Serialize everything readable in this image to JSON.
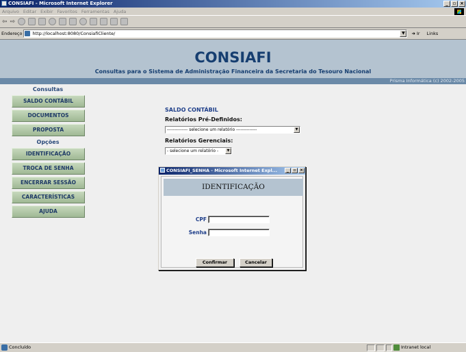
{
  "browser": {
    "window_title": "CONSIAFI - Microsoft Internet Explorer",
    "menu": [
      "Arquivo",
      "Editar",
      "Exibir",
      "Favoritos",
      "Ferramentas",
      "Ajuda"
    ],
    "address_label": "Endereço",
    "url": "http://localhost:8080/ConsiafiCliente/",
    "go_label": "Ir",
    "links_label": "Links",
    "status_text": "Concluído",
    "zone_text": "Intranet local"
  },
  "header": {
    "title": "CONSIAFI",
    "subtitle": "Consultas para o Sistema de Administração Financeira da Secretaria do Tesouro Nacional",
    "credit": "Prisma Informática (c) 2002-2005"
  },
  "sidebar": {
    "consultas_heading": "Consultas",
    "consultas_items": [
      "SALDO CONTÁBIL",
      "DOCUMENTOS",
      "PROPOSTA"
    ],
    "opcoes_heading": "Opções",
    "opcoes_items": [
      "IDENTIFICAÇÃO",
      "TROCA DE SENHA",
      "ENCERRAR SESSÃO",
      "CARACTERÍSTICAS",
      "AJUDA"
    ]
  },
  "main": {
    "section_title": "SALDO CONTÁBIL",
    "predefined_label": "Relatórios Pré-Definidos:",
    "predefined_selected": "-------------- selecione um relatório --------------",
    "managerial_label": "Relatórios Gerenciais:",
    "managerial_selected": "- selecione um relatório -"
  },
  "popup": {
    "window_title": "CONSIAFI_SENHA - Microsoft Internet Expl...",
    "heading": "IDENTIFICAÇÃO",
    "cpf_label": "CPF",
    "cpf_value": "",
    "senha_label": "Senha",
    "senha_value": "",
    "confirm_label": "Confirmar",
    "cancel_label": "Cancelar"
  }
}
